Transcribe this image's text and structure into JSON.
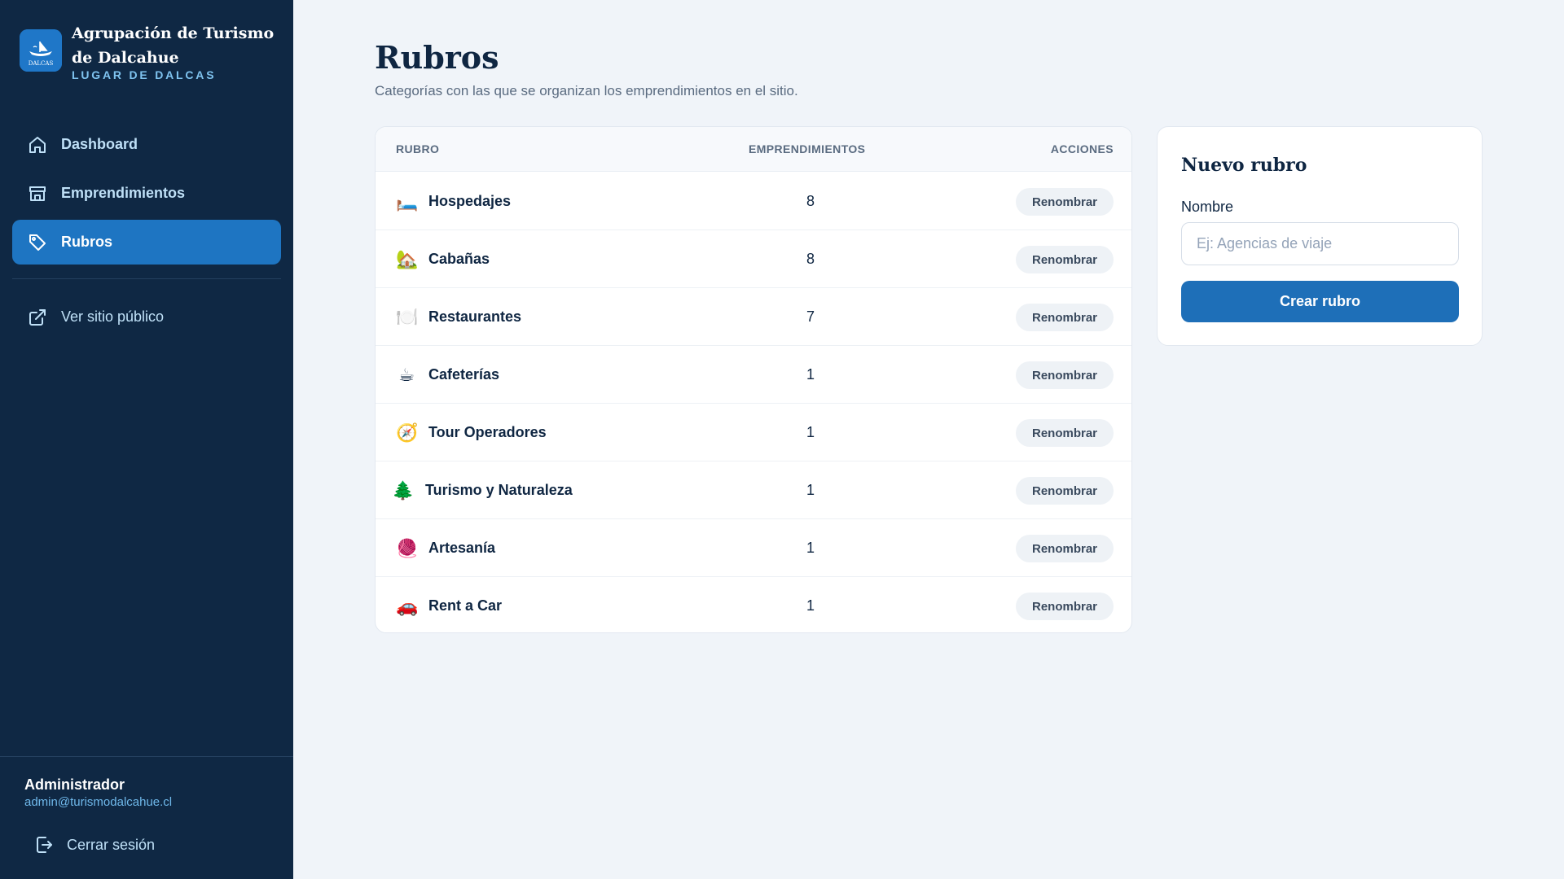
{
  "brand": {
    "title": "Agrupación de Turismo de Dalcahue",
    "subtitle": "LUGAR DE DALCAS",
    "logo_icon": "boat-logo-icon",
    "logo_text": "DALCAS"
  },
  "sidebar": {
    "items": [
      {
        "label": "Dashboard",
        "icon": "home-icon",
        "active": false
      },
      {
        "label": "Emprendimientos",
        "icon": "store-icon",
        "active": false
      },
      {
        "label": "Rubros",
        "icon": "tag-icon",
        "active": true
      }
    ],
    "public_link": {
      "label": "Ver sitio público",
      "icon": "external-link-icon"
    }
  },
  "user": {
    "name": "Administrador",
    "email": "admin@turismodalcahue.cl",
    "logout_label": "Cerrar sesión"
  },
  "page": {
    "title": "Rubros",
    "subtitle": "Categorías con las que se organizan los emprendimientos en el sitio."
  },
  "table": {
    "headers": {
      "rubro": "RUBRO",
      "emprendimientos": "EMPRENDIMIENTOS",
      "acciones": "ACCIONES"
    },
    "rows": [
      {
        "icon": "bed-icon",
        "glyph": "🛏️",
        "name": "Hospedajes",
        "count": "8",
        "action": "Renombrar"
      },
      {
        "icon": "house-icon",
        "glyph": "🏡",
        "name": "Cabañas",
        "count": "8",
        "action": "Renombrar"
      },
      {
        "icon": "plate-cutlery-icon",
        "glyph": "🍽️",
        "name": "Restaurantes",
        "count": "7",
        "action": "Renombrar"
      },
      {
        "icon": "coffee-cup-icon",
        "glyph": "☕",
        "name": "Cafeterías",
        "count": "1",
        "action": "Renombrar"
      },
      {
        "icon": "compass-icon",
        "glyph": "🧭",
        "name": "Tour Operadores",
        "count": "1",
        "action": "Renombrar"
      },
      {
        "icon": "tree-icon",
        "glyph": "🌲",
        "name": "Turismo y Naturaleza",
        "count": "1",
        "action": "Renombrar"
      },
      {
        "icon": "yarn-icon",
        "glyph": "🧶",
        "name": "Artesanía",
        "count": "1",
        "action": "Renombrar"
      },
      {
        "icon": "car-icon",
        "glyph": "🚗",
        "name": "Rent a Car",
        "count": "1",
        "action": "Renombrar"
      }
    ]
  },
  "form": {
    "title": "Nuevo rubro",
    "label": "Nombre",
    "placeholder": "Ej: Agencias de viaje",
    "value": "",
    "submit_label": "Crear rubro"
  },
  "colors": {
    "sidebar_bg": "#0f2844",
    "accent": "#1e75c2",
    "page_bg": "#f0f4f9",
    "text_primary": "#0f2642"
  }
}
